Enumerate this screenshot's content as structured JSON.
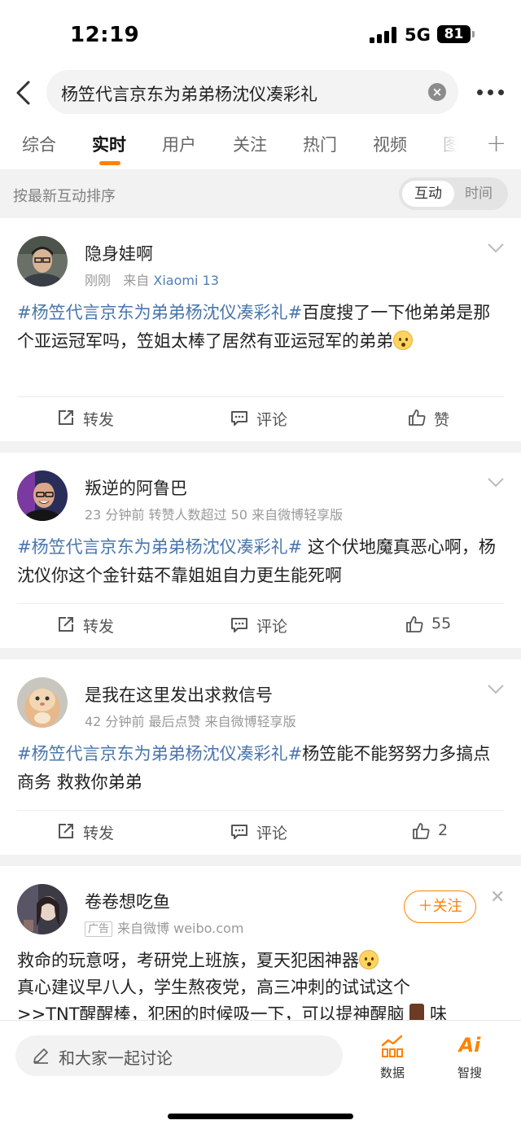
{
  "status_bar": {
    "time": "12:19",
    "network": "5G",
    "battery": "81"
  },
  "search": {
    "query": "杨笠代言京东为弟弟杨沈仪凑彩礼"
  },
  "tabs": [
    "综合",
    "实时",
    "用户",
    "关注",
    "热门",
    "视频",
    "图"
  ],
  "active_tab": "实时",
  "sort": {
    "label": "按最新互动排序",
    "option_active": "互动",
    "option_inactive": "时间"
  },
  "posts": [
    {
      "username": "隐身娃啊",
      "time": "刚刚",
      "source_prefix": "来自",
      "source": "Xiaomi 13",
      "hashtag": "#杨笠代言京东为弟弟杨沈仪凑彩礼#",
      "text": "百度搜了一下他弟弟是那个亚运冠军吗，笠姐太棒了居然有亚运冠军的弟弟",
      "repost": "转发",
      "comment": "评论",
      "like": "赞"
    },
    {
      "username": "叛逆的阿鲁巴",
      "meta": "23 分钟前  转赞人数超过 50  来自微博轻享版",
      "hashtag": "#杨笠代言京东为弟弟杨沈仪凑彩礼#",
      "text": " 这个伏地魔真恶心啊，杨沈仪你这个金针菇不靠姐姐自力更生能死啊",
      "repost": "转发",
      "comment": "评论",
      "like": "55"
    },
    {
      "username": "是我在这里发出求救信号",
      "meta": "42 分钟前  最后点赞  来自微博轻享版",
      "hashtag": "#杨笠代言京东为弟弟杨沈仪凑彩礼#",
      "text": "杨笠能不能努努力多搞点商务 救救你弟弟",
      "repost": "转发",
      "comment": "评论",
      "like": "2"
    }
  ],
  "ad": {
    "username": "卷卷想吃鱼",
    "badge": "广告",
    "source": "来自微博 weibo.com",
    "follow": "＋关注",
    "line1": "救命的玩意呀，考研党上班族，夏天犯困神器",
    "line2": "真心建议早八人，学生熬夜党，高三冲刺的试试这个",
    "line3": ">>TNT醒醒棒，犯困的时候吸一下，可以提神醒脑",
    "line3_tail": "味"
  },
  "bottom": {
    "placeholder": "和大家一起讨论",
    "data_label": "数据",
    "ai_label": "智搜",
    "ai_icon_text": "Ai"
  },
  "colors": {
    "accent": "#ff8200",
    "hashtag": "#4a76ad",
    "source_link": "#4f7fb4"
  }
}
